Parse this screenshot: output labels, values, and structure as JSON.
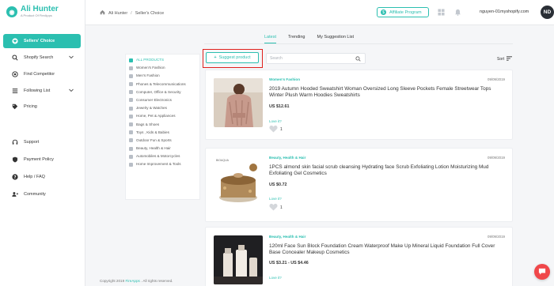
{
  "app": {
    "logo_title": "Ali Hunter",
    "logo_subtitle": "A Product Of FireApps"
  },
  "sidebar": {
    "items": [
      {
        "label": "Sellers' Choice",
        "icon": "heart-icon",
        "active": true
      },
      {
        "label": "Shopify Search",
        "icon": "search-icon",
        "has_chevron": true
      },
      {
        "label": "Find Competitor",
        "icon": "target-icon"
      },
      {
        "label": "Following List",
        "icon": "list-icon",
        "has_chevron": true
      },
      {
        "label": "Pricing",
        "icon": "tag-icon"
      },
      {
        "label": "Support",
        "icon": "headset-icon"
      },
      {
        "label": "Payment Policy",
        "icon": "shield-icon"
      },
      {
        "label": "Help / FAQ",
        "icon": "question-icon"
      },
      {
        "label": "Community",
        "icon": "community-icon"
      }
    ]
  },
  "header": {
    "breadcrumb_home": "Ali Hunter",
    "breadcrumb_separator": "/",
    "breadcrumb_current": "Seller's Choice",
    "affiliate_label": "Affiliate Program",
    "email": "nguyen-01myshopify.com",
    "avatar_initials": "ND"
  },
  "tabs": [
    {
      "label": "Latest",
      "active": true
    },
    {
      "label": "Trending",
      "active": false
    },
    {
      "label": "My Suggestion List",
      "active": false
    }
  ],
  "categories": [
    {
      "label": "ALL PRODUCTS",
      "active": true
    },
    {
      "label": "Women's Fashion"
    },
    {
      "label": "Men's Fashion"
    },
    {
      "label": "Phones & Telecommunications"
    },
    {
      "label": "Computer, Office & Security"
    },
    {
      "label": "Consumer Electronics"
    },
    {
      "label": "Jewelry & Watches"
    },
    {
      "label": "Home, Pet & Appliances"
    },
    {
      "label": "Bags & Shoes"
    },
    {
      "label": "Toys , Kids & Babies"
    },
    {
      "label": "Outdoor Fun & Sports"
    },
    {
      "label": "Beauty, Health & Hair"
    },
    {
      "label": "Automobiles & Motorcycles"
    },
    {
      "label": "Home Improvement & Tools"
    }
  ],
  "toolbar": {
    "suggest_label": "Suggest product",
    "suggest_prefix": "+",
    "search_placeholder": "Search",
    "sort_label": "Sort"
  },
  "products": [
    {
      "category": "Women's Fashion",
      "date": "09/09/2019",
      "title": "2019 Autumn Hooded Sweatshirt Woman Oversized Long Sleeve Pockets Female Streetwear Tops Winter Plush Warm Hoodies Sweatshirts",
      "price": "US $12.61",
      "love_label": "Love it?",
      "likes": "1"
    },
    {
      "category": "Beauty, Health & Hair",
      "date": "09/09/2019",
      "title": "1PCS almond skin facial scrub cleansing Hydrating face Scrub Exfoliating Lotion Moisturizing Mud Exfoliating Gel Cosmetics",
      "price": "US $0.72",
      "love_label": "Love it?",
      "likes": "1",
      "thumb_caption": "BIOAQUA"
    },
    {
      "category": "Beauty, Health & Hair",
      "date": "09/09/2019",
      "title": "120ml Face Sun Block Foundation Cream Waterproof Make Up Mineral Liquid Foundation Full Cover Base Concealer Makeup Cosmetics",
      "price": "US $3.21 - US $4.46",
      "love_label": "Love it?"
    }
  ],
  "footer": {
    "copyright": "Copyright 2019",
    "company": "FireApps",
    "rights": ". All rights reserved."
  },
  "colors": {
    "accent": "#2bbfb0",
    "highlight_box": "#e0201c",
    "chat_button": "#f0474a"
  }
}
